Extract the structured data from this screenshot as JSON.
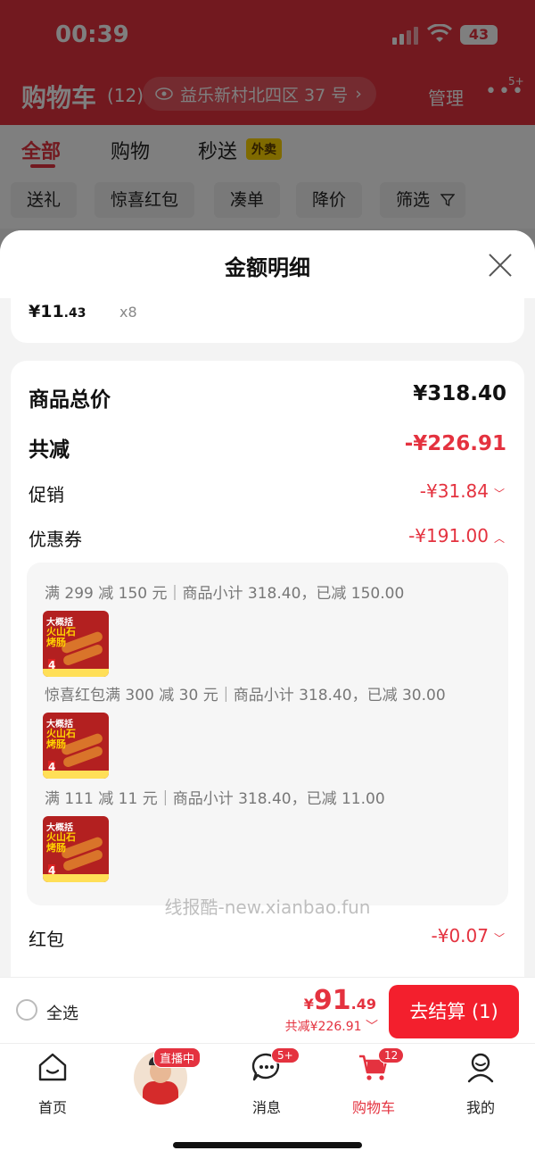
{
  "status": {
    "time": "00:39",
    "battery": "43"
  },
  "header": {
    "title": "购物车",
    "count": "(12)",
    "address": "益乐新村北四区 37 号",
    "manage": "管理",
    "more_badge": "5+"
  },
  "tabs": [
    {
      "label": "全部"
    },
    {
      "label": "购物"
    },
    {
      "label": "秒送"
    }
  ],
  "waimai_badge": "外卖",
  "chips": [
    {
      "label": "送礼"
    },
    {
      "label": "惊喜红包"
    },
    {
      "label": "凑单"
    },
    {
      "label": "降价"
    },
    {
      "label": "筛选"
    }
  ],
  "sheet": {
    "title": "金额明细",
    "item_price_int": "¥11",
    "item_price_dec": ".43",
    "item_qty": "x8",
    "rows": {
      "total_label": "商品总价",
      "total_value": "¥318.40",
      "discount_label": "共减",
      "discount_value": "-¥226.91",
      "promo_label": "促销",
      "promo_value": "-¥31.84",
      "coupon_label": "优惠券",
      "coupon_value": "-¥191.00",
      "redpacket_label": "红包",
      "redpacket_value": "-¥0.07"
    },
    "coupon_details": [
      {
        "text": "满 299 减 150 元｜商品小计 318.40，已减 150.00"
      },
      {
        "text": "惊喜红包满 300 减 30 元｜商品小计 318.40，已减 30.00"
      },
      {
        "text": "满 111 减 11 元｜商品小计 318.40，已减 11.00"
      }
    ],
    "thumb": {
      "tag": "大概括",
      "name": "火山石\n烤肠",
      "count": "4"
    }
  },
  "watermark": "线报酷-new.xianbao.fun",
  "checkout": {
    "select_all": "全选",
    "currency": "¥",
    "price_int": "91",
    "price_dec": ".49",
    "saved": "共减¥226.91",
    "button": "去结算 (1)"
  },
  "tabbar": {
    "home": "首页",
    "live_badge": "直播中",
    "messages": "消息",
    "messages_badge": "5+",
    "cart": "购物车",
    "cart_badge": "12",
    "mine": "我的"
  },
  "colors": {
    "brand_red": "#e4323f",
    "button_red": "#f31f2d"
  }
}
